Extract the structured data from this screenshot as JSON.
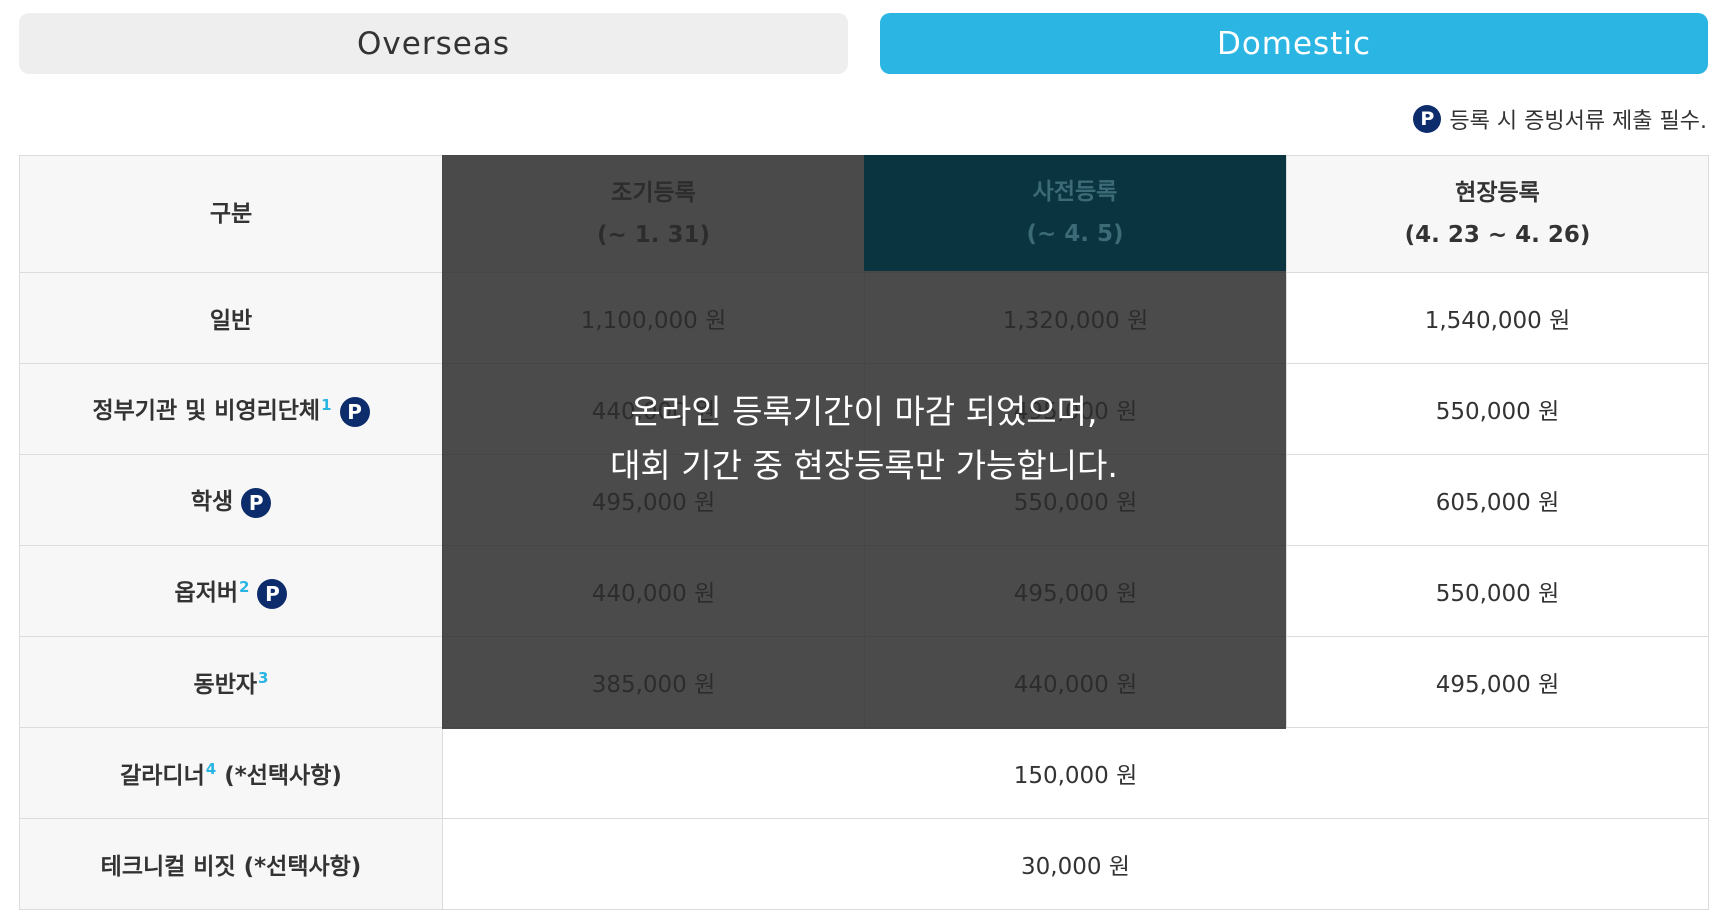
{
  "tabs": [
    {
      "label": "Overseas",
      "active": false
    },
    {
      "label": "Domestic",
      "active": true
    }
  ],
  "note": {
    "badge": "P",
    "text": "등록 시 증빙서류 제출 필수."
  },
  "table": {
    "header": {
      "category": "구분",
      "early": {
        "label": "조기등록",
        "period": "(~ 1. 31)"
      },
      "pre": {
        "label": "사전등록",
        "period": "(~ 4. 5)"
      },
      "onsite": {
        "label": "현장등록",
        "period": "(4. 23 ~ 4. 26)"
      }
    },
    "rows": [
      {
        "category": "일반",
        "sup": "",
        "badge": "",
        "early": "1,100,000 원",
        "pre": "1,320,000 원",
        "onsite": "1,540,000 원"
      },
      {
        "category": "정부기관 및 비영리단체",
        "sup": "1",
        "badge": "P",
        "early": "440,000 원",
        "pre": "495,000 원",
        "onsite": "550,000 원"
      },
      {
        "category": "학생",
        "sup": "",
        "badge": "P",
        "early": "495,000 원",
        "pre": "550,000 원",
        "onsite": "605,000 원"
      },
      {
        "category": "옵저버",
        "sup": "2",
        "badge": "P",
        "early": "440,000 원",
        "pre": "495,000 원",
        "onsite": "550,000 원"
      },
      {
        "category": "동반자",
        "sup": "3",
        "badge": "",
        "early": "385,000 원",
        "pre": "440,000 원",
        "onsite": "495,000 원"
      }
    ],
    "options": [
      {
        "category": "갈라디너",
        "sup": "4",
        "suffix": " (*선택사항)",
        "price": "150,000 원"
      },
      {
        "category": "테크니컬 비짓",
        "sup": "",
        "suffix": " (*선택사항)",
        "price": "30,000 원"
      }
    ]
  },
  "overlay": {
    "line1": "온라인 등록기간이 마감 되었으며,",
    "line2": "대회 기간 중 현장등록만 가능합니다."
  },
  "colors": {
    "accent": "#2bb5e3",
    "badge": "#0d2c6c",
    "overlay": "#2b2b2b",
    "highlight": "#0a3440"
  }
}
